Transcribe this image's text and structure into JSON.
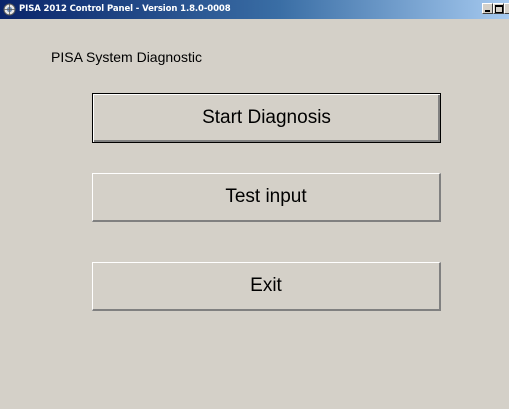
{
  "window": {
    "title": "PISA 2012 Control Panel - Version 1.8.0-0008",
    "icon": "pisa-logo-icon",
    "controls": {
      "minimize": "minimize-icon",
      "maximize": "maximize-icon",
      "close": "close-icon"
    }
  },
  "main": {
    "heading": "PISA System Diagnostic",
    "buttons": {
      "start": "Start Diagnosis",
      "test": "Test input",
      "exit": "Exit"
    }
  },
  "colors": {
    "title_bar_start": "#0a246a",
    "title_bar_end": "#a6caf0",
    "window_face": "#d4d0c8"
  }
}
